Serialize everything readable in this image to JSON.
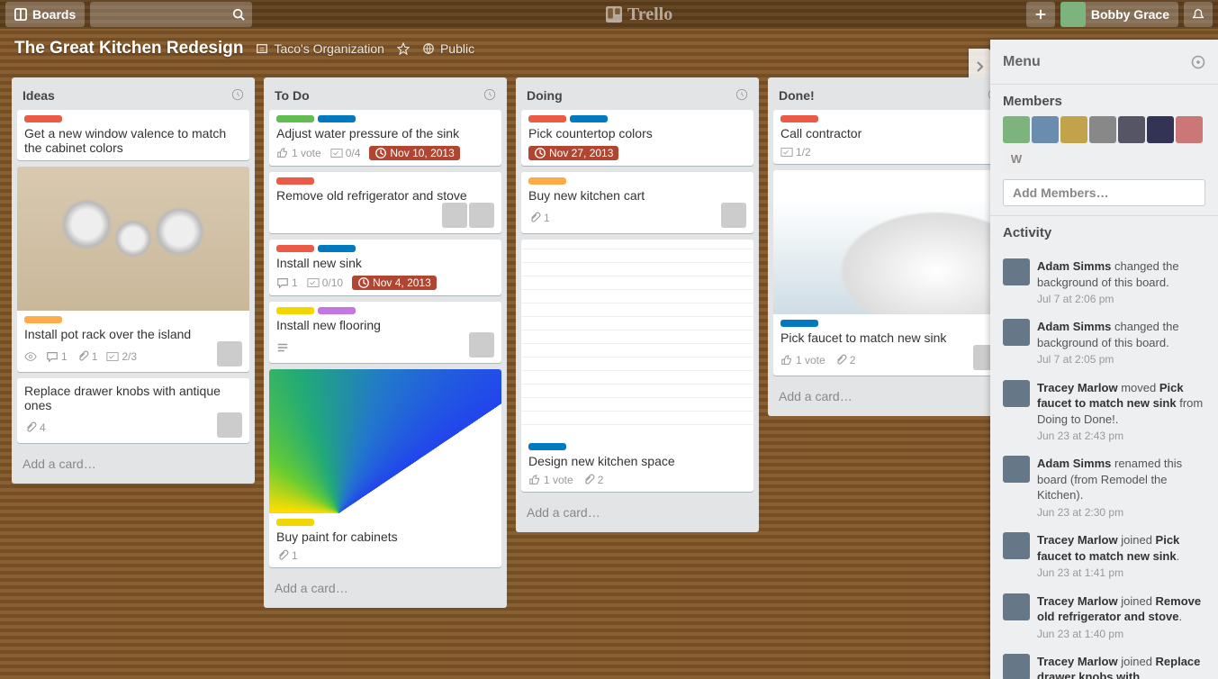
{
  "topbar": {
    "boards_label": "Boards",
    "logo_text": "Trello",
    "user_name": "Bobby Grace"
  },
  "board_header": {
    "title": "The Great Kitchen Redesign",
    "org": "Taco's Organization",
    "visibility": "Public"
  },
  "lists": [
    {
      "title": "Ideas",
      "cards": [
        {
          "labels": [
            "red"
          ],
          "title": "Get a new window valence to match the cabinet colors"
        },
        {
          "labels": [
            "orange"
          ],
          "image": "pots",
          "title": "Install pot rack over the island",
          "badges": {
            "watch": true,
            "comments": 1,
            "attachments": 1,
            "checklist": "2/3"
          },
          "member": true
        },
        {
          "title": "Replace drawer knobs with antique ones",
          "badges": {
            "attachments": 4
          },
          "member": true
        }
      ],
      "add": "Add a card…"
    },
    {
      "title": "To Do",
      "cards": [
        {
          "labels": [
            "green",
            "blue"
          ],
          "title": "Adjust water pressure of the sink",
          "badges": {
            "votes": "1 vote",
            "checklist": "0/4",
            "due": "Nov 10, 2013",
            "due_over": true
          }
        },
        {
          "labels": [
            "red"
          ],
          "title": "Remove old refrigerator and stove",
          "members": 2
        },
        {
          "labels": [
            "red",
            "blue"
          ],
          "title": "Install new sink",
          "badges": {
            "comments": 1,
            "checklist": "0/10",
            "due": "Nov 4, 2013",
            "due_over": true
          }
        },
        {
          "labels": [
            "yellow",
            "purple"
          ],
          "title": "Install new flooring",
          "badges": {
            "desc": true
          },
          "member": true
        },
        {
          "labels": [
            "yellow"
          ],
          "image": "swatch",
          "title": "Buy paint for cabinets",
          "badges": {
            "attachments": 1
          }
        }
      ],
      "add": "Add a card…"
    },
    {
      "title": "Doing",
      "cards": [
        {
          "labels": [
            "red",
            "blue"
          ],
          "title": "Pick countertop colors",
          "badges": {
            "due": "Nov 27, 2013",
            "due_over": true
          }
        },
        {
          "labels": [
            "orange"
          ],
          "title": "Buy new kitchen cart",
          "badges": {
            "attachments": 1
          },
          "member": true
        },
        {
          "labels": [
            "blue"
          ],
          "image": "blueprint",
          "title": "Design new kitchen space",
          "badges": {
            "votes": "1 vote",
            "attachments": 2
          }
        }
      ],
      "add": "Add a card…"
    },
    {
      "title": "Done!",
      "cards": [
        {
          "labels": [
            "red"
          ],
          "title": "Call contractor",
          "badges": {
            "checklist": "1/2"
          }
        },
        {
          "labels": [
            "blue"
          ],
          "image": "faucet",
          "title": "Pick faucet to match new sink",
          "badges": {
            "votes": "1 vote",
            "attachments": 2
          },
          "member": true
        }
      ],
      "add": "Add a card…"
    }
  ],
  "menu": {
    "title": "Menu",
    "members_heading": "Members",
    "member_count": 7,
    "extra_member_initial": "W",
    "add_members": "Add Members…",
    "activity_heading": "Activity",
    "activity": [
      {
        "who": "Adam Simms",
        "text": " changed the background of this board.",
        "ts": "Jul 7 at 2:06 pm"
      },
      {
        "who": "Adam Simms",
        "text": " changed the background of this board.",
        "ts": "Jul 7 at 2:05 pm"
      },
      {
        "who": "Tracey Marlow",
        "pre": " moved ",
        "bold": "Pick faucet to match new sink",
        "post": " from Doing to Done!.",
        "ts": "Jun 23 at 2:43 pm"
      },
      {
        "who": "Adam Simms",
        "text": " renamed this board (from Remodel the Kitchen). ",
        "ts": "Jun 23 at 2:30 pm"
      },
      {
        "who": "Tracey Marlow",
        "pre": " joined ",
        "bold": "Pick faucet to match new sink",
        "post": ".",
        "ts": "Jun 23 at 1:41 pm"
      },
      {
        "who": "Tracey Marlow",
        "pre": " joined ",
        "bold": "Remove old refrigerator and stove",
        "post": ". ",
        "ts": "Jun 23 at 1:40 pm"
      },
      {
        "who": "Tracey Marlow",
        "pre": " joined ",
        "bold": "Replace drawer knobs with",
        "post": "",
        "ts": ""
      }
    ]
  }
}
